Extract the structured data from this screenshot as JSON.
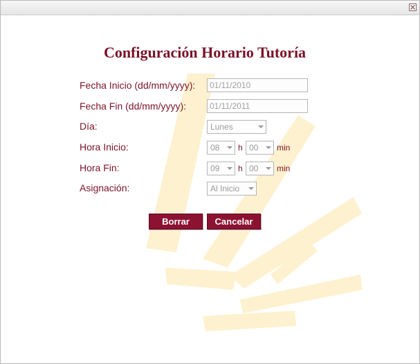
{
  "dialog": {
    "title": "Configuración Horario Tutoría",
    "close_icon": "close-icon"
  },
  "form": {
    "fecha_inicio": {
      "label": "Fecha Inicio (dd/mm/yyyy):",
      "value": "01/11/2010"
    },
    "fecha_fin": {
      "label": "Fecha Fin (dd/mm/yyyy):",
      "value": "01/11/2011"
    },
    "dia": {
      "label": "Día:",
      "value": "Lunes"
    },
    "hora_inicio": {
      "label": "Hora Inicio:",
      "hour": "08",
      "minute": "00"
    },
    "hora_fin": {
      "label": "Hora Fin:",
      "hour": "09",
      "minute": "00"
    },
    "asignacion": {
      "label": "Asignación:",
      "value": "Al Inicio"
    },
    "hour_unit": "h",
    "minute_unit": "min"
  },
  "buttons": {
    "borrar": "Borrar",
    "cancelar": "Cancelar"
  },
  "colors": {
    "accent": "#7a1228",
    "button": "#8c1232",
    "watermark": "#fdf1cf"
  }
}
